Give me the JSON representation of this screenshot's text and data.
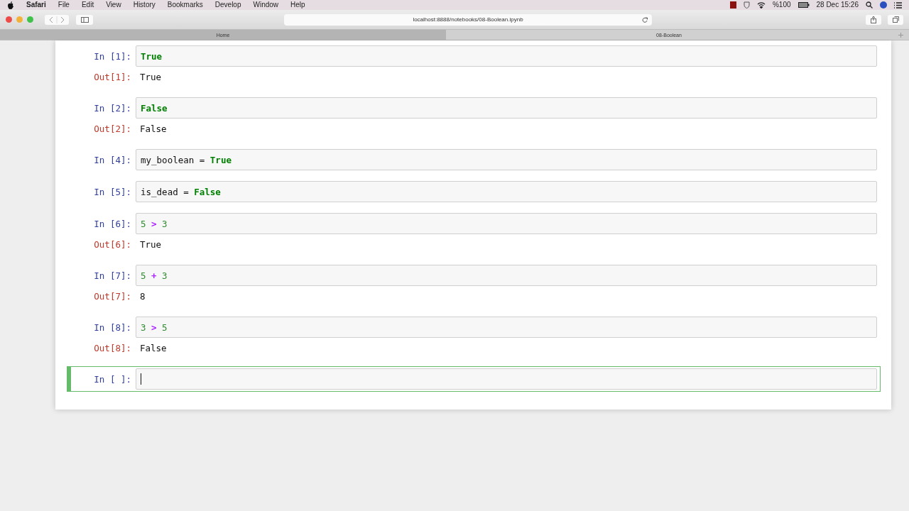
{
  "menu_bar": {
    "app": "Safari",
    "items": [
      "File",
      "Edit",
      "View",
      "History",
      "Bookmarks",
      "Develop",
      "Window",
      "Help"
    ],
    "battery": "%100",
    "clock": "28 Dec 15:26"
  },
  "toolbar": {
    "address": "localhost:8888/notebooks/08-Boolean.ipynb"
  },
  "tabs": [
    {
      "label": "Home",
      "selected": false
    },
    {
      "label": "08-Boolean",
      "selected": true
    }
  ],
  "cells": [
    {
      "prompt": "In [1]:",
      "code": [
        {
          "kind": "kw",
          "text": "True"
        }
      ],
      "output_prompt": "Out[1]:",
      "output": "True",
      "selected": false
    },
    {
      "prompt": "In [2]:",
      "code": [
        {
          "kind": "kw",
          "text": "False"
        }
      ],
      "output_prompt": "Out[2]:",
      "output": "False",
      "selected": false
    },
    {
      "prompt": "In [4]:",
      "code": [
        {
          "kind": "plain",
          "text": "my_boolean = "
        },
        {
          "kind": "kw",
          "text": "True"
        }
      ],
      "selected": false
    },
    {
      "prompt": "In [5]:",
      "code": [
        {
          "kind": "plain",
          "text": "is_dead = "
        },
        {
          "kind": "kw",
          "text": "False"
        }
      ],
      "selected": false
    },
    {
      "prompt": "In [6]:",
      "code": [
        {
          "kind": "num",
          "text": "5 "
        },
        {
          "kind": "op",
          "text": ">"
        },
        {
          "kind": "num",
          "text": " 3"
        }
      ],
      "output_prompt": "Out[6]:",
      "output": "True",
      "selected": false
    },
    {
      "prompt": "In [7]:",
      "code": [
        {
          "kind": "num",
          "text": "5 "
        },
        {
          "kind": "op",
          "text": "+"
        },
        {
          "kind": "num",
          "text": " 3"
        }
      ],
      "output_prompt": "Out[7]:",
      "output": "8",
      "selected": false
    },
    {
      "prompt": "In [8]:",
      "code": [
        {
          "kind": "num",
          "text": "3 "
        },
        {
          "kind": "op",
          "text": ">"
        },
        {
          "kind": "num",
          "text": " 5"
        }
      ],
      "output_prompt": "Out[8]:",
      "output": "False",
      "selected": false
    },
    {
      "prompt": "In [ ]:",
      "selected": true
    }
  ]
}
